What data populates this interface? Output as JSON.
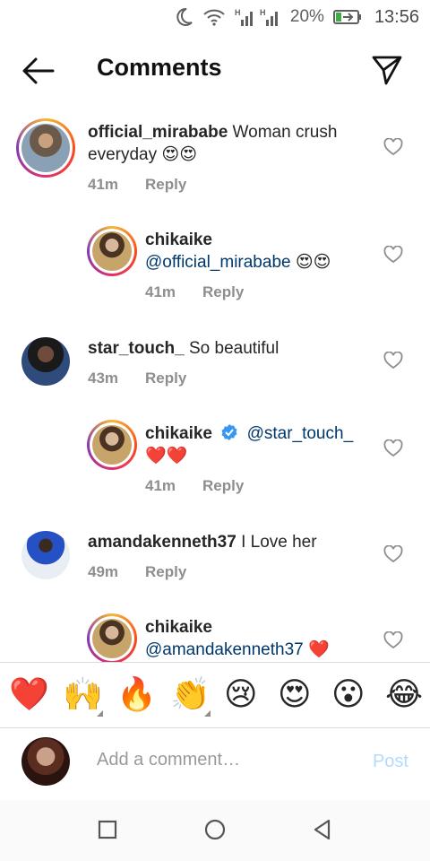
{
  "status": {
    "battery": "20%",
    "time": "13:56",
    "signal_tag": "H"
  },
  "header": {
    "title": "Comments"
  },
  "comments": [
    {
      "user": "official_mirababe",
      "text": " Woman crush everyday",
      "emoji": " 😍😍",
      "time": "41m",
      "reply": "Reply"
    },
    {
      "user": "chikaike",
      "text": "@official_mirababe",
      "emoji": " 😍😍",
      "time": "41m",
      "reply": "Reply"
    },
    {
      "user": "star_touch_",
      "text": " So beautiful",
      "time": "43m",
      "reply": "Reply"
    },
    {
      "user": "chikaike",
      "text": "@star_touch_",
      "emoji": "❤️❤️",
      "time": "41m",
      "reply": "Reply"
    },
    {
      "user": "amandakenneth37",
      "text": " I Love her",
      "time": "49m",
      "reply": "Reply"
    },
    {
      "user": "chikaike",
      "text": "@amandakenneth37",
      "emoji": " ❤️"
    }
  ],
  "emoji_bar": [
    "❤️",
    "🙌",
    "🔥",
    "👏",
    "😢",
    "😍",
    "😮",
    "😂"
  ],
  "composer": {
    "placeholder": "Add a comment…",
    "post_label": "Post"
  },
  "colors": {
    "link": "#00376b",
    "post_disabled": "#b3dbff",
    "verified": "#3897f0"
  }
}
